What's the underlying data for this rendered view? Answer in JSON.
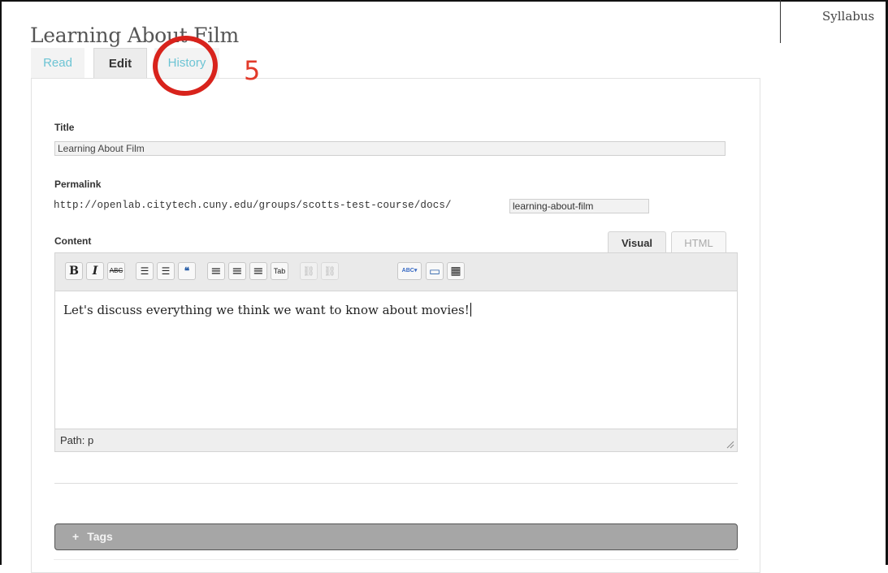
{
  "sidebar": {
    "link_label": "Syllabus"
  },
  "page": {
    "title": "Learning About Film"
  },
  "tabs": [
    {
      "label": "Read"
    },
    {
      "label": "Edit",
      "active": true
    },
    {
      "label": "History"
    }
  ],
  "annotation": {
    "number": "5",
    "color": "#d8231c"
  },
  "form": {
    "title_label": "Title",
    "title_value": "Learning About Film",
    "permalink_label": "Permalink",
    "permalink_base": "http://openlab.citytech.cuny.edu/groups/scotts-test-course/docs/",
    "permalink_slug": "learning-about-film",
    "content_label": "Content"
  },
  "editor": {
    "tabs": {
      "visual": "Visual",
      "html": "HTML"
    },
    "toolbar": [
      {
        "name": "bold-button",
        "glyph": "B"
      },
      {
        "name": "italic-button",
        "glyph": "I"
      },
      {
        "name": "strikethrough-button",
        "glyph": "ABC"
      },
      {
        "name": "bullet-list-button",
        "glyph": "☰"
      },
      {
        "name": "numbered-list-button",
        "glyph": "☰"
      },
      {
        "name": "blockquote-button",
        "glyph": "❝"
      },
      {
        "name": "align-left-button",
        "glyph": "≡"
      },
      {
        "name": "align-center-button",
        "glyph": "≡"
      },
      {
        "name": "align-right-button",
        "glyph": "≡"
      },
      {
        "name": "indent-button",
        "glyph": "Tab"
      },
      {
        "name": "insert-link-button",
        "glyph": "⛓"
      },
      {
        "name": "unlink-button",
        "glyph": "⛓"
      },
      {
        "name": "spellcheck-button",
        "glyph": "ABC"
      },
      {
        "name": "fullscreen-button",
        "glyph": "▭"
      },
      {
        "name": "kitchen-sink-button",
        "glyph": "▦"
      }
    ],
    "content_text": "Let's discuss everything we think we want to know about movies!",
    "path_text": "Path: p"
  },
  "tags": {
    "plus": "+",
    "label": "Tags"
  },
  "colors": {
    "link": "#6cc4d4",
    "tags_bar": "#a6a6a6"
  }
}
